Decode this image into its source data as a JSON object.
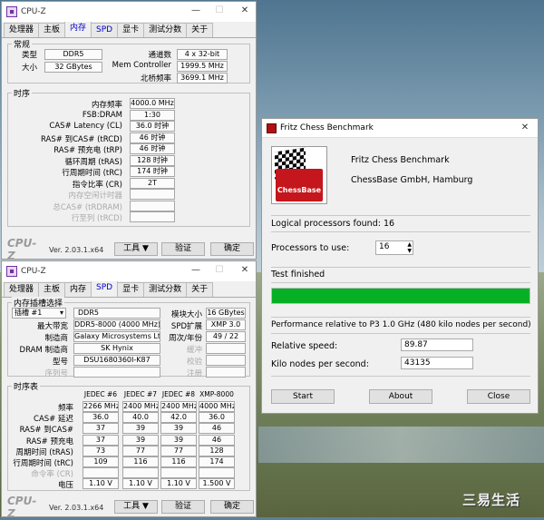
{
  "cpuz1": {
    "title": "CPU-Z",
    "tabs": [
      "处理器",
      "主板",
      "内存",
      "SPD",
      "显卡",
      "测试分数",
      "关于"
    ],
    "general": {
      "label": "常规",
      "type_label": "类型",
      "type": "DDR5",
      "size_label": "大小",
      "size": "32 GBytes",
      "channels_label": "通道数",
      "channels": "4 x 32-bit",
      "memctrl_label": "Mem Controller",
      "memctrl": "1999.5 MHz",
      "nb_label": "北桥频率",
      "nb": "3699.1 MHz"
    },
    "timings": {
      "label": "时序",
      "rows": [
        {
          "label": "内存频率",
          "value": "4000.0 MHz",
          "gray": false
        },
        {
          "label": "FSB:DRAM",
          "value": "1:30",
          "gray": false
        },
        {
          "label": "CAS# Latency (CL)",
          "value": "36.0 时钟",
          "gray": false
        },
        {
          "label": "RAS# 到CAS# (tRCD)",
          "value": "46 时钟",
          "gray": false
        },
        {
          "label": "RAS# 预充电 (tRP)",
          "value": "46 时钟",
          "gray": false
        },
        {
          "label": "循环周期 (tRAS)",
          "value": "128 时钟",
          "gray": false
        },
        {
          "label": "行周期时间 (tRC)",
          "value": "174 时钟",
          "gray": false
        },
        {
          "label": "指令比率 (CR)",
          "value": "2T",
          "gray": false
        },
        {
          "label": "内存空闲计时器",
          "value": "",
          "gray": true
        },
        {
          "label": "总CAS# (tRDRAM)",
          "value": "",
          "gray": true
        },
        {
          "label": "行至列 (tRCD)",
          "value": "",
          "gray": true
        }
      ]
    },
    "footer": {
      "logo": "CPU-Z",
      "version": "Ver. 2.03.1.x64",
      "tools": "工具",
      "validate": "验证",
      "ok": "确定"
    }
  },
  "cpuz2": {
    "title": "CPU-Z",
    "tabs": [
      "处理器",
      "主板",
      "内存",
      "SPD",
      "显卡",
      "测试分数",
      "关于"
    ],
    "slot": {
      "label": "内存插槽选择",
      "slot_value": "插槽 #1",
      "type": "DDR5",
      "module_size_label": "模块大小",
      "module_size": "16 GBytes",
      "maxbw_label": "最大带宽",
      "maxbw": "DDR5-8000 (4000 MHz)",
      "spd_ext_label": "SPD扩展",
      "spd_ext": "XMP 3.0",
      "mfr_label": "制造商",
      "mfr": "Galaxy Microsystems Ltd.",
      "week_label": "周次/年份",
      "week": "49 / 22",
      "dram_label": "DRAM 制造商",
      "dram": "SK Hynix",
      "buffered_label": "缓冲",
      "part_label": "型号",
      "part": "DSU1680360I-K87",
      "correction_label": "校验",
      "serial_label": "序列号",
      "registered_label": "注册"
    },
    "table": {
      "label": "时序表",
      "headers": [
        "JEDEC #6",
        "JEDEC #7",
        "JEDEC #8",
        "XMP-8000"
      ],
      "rows": [
        {
          "label": "频率",
          "v": [
            "2266 MHz",
            "2400 MHz",
            "2400 MHz",
            "4000 MHz"
          ],
          "gray": false
        },
        {
          "label": "CAS# 延迟",
          "v": [
            "36.0",
            "40.0",
            "42.0",
            "36.0"
          ],
          "gray": false
        },
        {
          "label": "RAS# 到CAS#",
          "v": [
            "37",
            "39",
            "39",
            "46"
          ],
          "gray": false
        },
        {
          "label": "RAS# 预充电",
          "v": [
            "37",
            "39",
            "39",
            "46"
          ],
          "gray": false
        },
        {
          "label": "周期时间 (tRAS)",
          "v": [
            "73",
            "77",
            "77",
            "128"
          ],
          "gray": false
        },
        {
          "label": "行周期时间 (tRC)",
          "v": [
            "109",
            "116",
            "116",
            "174"
          ],
          "gray": false
        },
        {
          "label": "命令率 (CR)",
          "v": [
            "",
            "",
            "",
            ""
          ],
          "gray": true
        },
        {
          "label": "电压",
          "v": [
            "1.10 V",
            "1.10 V",
            "1.10 V",
            "1.500 V"
          ],
          "gray": false
        }
      ]
    },
    "footer": {
      "logo": "CPU-Z",
      "version": "Ver. 2.03.1.x64",
      "tools": "工具",
      "validate": "验证",
      "ok": "确定"
    }
  },
  "fritz": {
    "title": "Fritz Chess Benchmark",
    "logo_text": "ChessBase",
    "app_name": "Fritz Chess Benchmark",
    "company": "ChessBase GmbH, Hamburg",
    "logical": "Logical processors found: 16",
    "proc_label": "Processors to use:",
    "proc_value": "16",
    "status": "Test finished",
    "progress": 1.0,
    "perf": "Performance relative to P3 1.0 GHz (480 kilo nodes per second)",
    "rel_label": "Relative speed:",
    "rel_value": "89.87",
    "kn_label": "Kilo nodes per second:",
    "kn_value": "43135",
    "start": "Start",
    "about": "About",
    "close": "Close"
  },
  "watermark": "三易生活"
}
